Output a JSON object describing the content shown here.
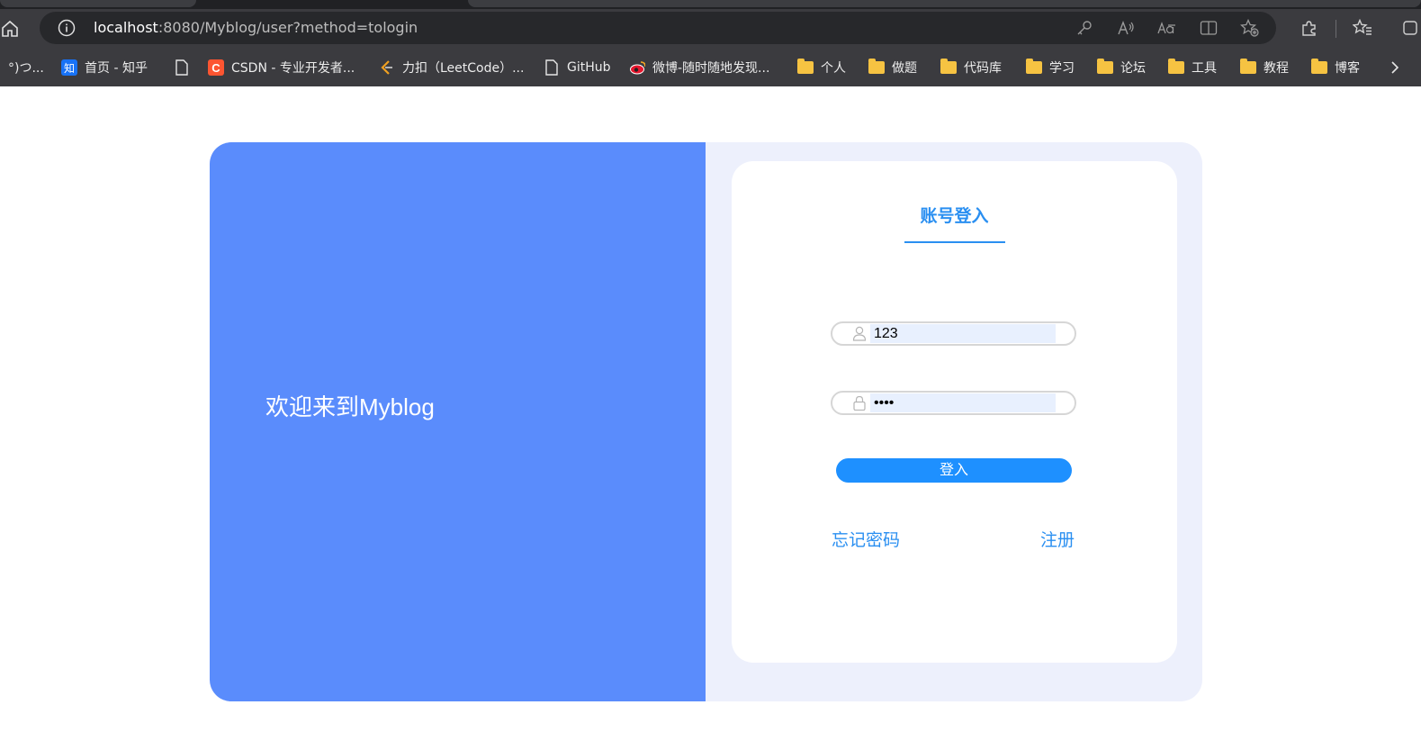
{
  "browser": {
    "url_host": "localhost",
    "url_rest": ":8080/Myblog/user?method=tologin",
    "url_icons": [
      "key-icon",
      "read-aloud-icon",
      "translate-icon",
      "split-screen-icon",
      "add-favorite-icon"
    ],
    "toolbar_icons": [
      "extensions-icon",
      "favorites-icon",
      "collections-icon"
    ]
  },
  "bookmarks": [
    {
      "label": "°)つ...",
      "icon": "none"
    },
    {
      "label": "首页 - 知乎",
      "icon": "zhihu-icon"
    },
    {
      "label": "",
      "icon": "page-icon"
    },
    {
      "label": "CSDN - 专业开发者...",
      "icon": "csdn-icon"
    },
    {
      "label": "力扣（LeetCode）...",
      "icon": "leetcode-icon"
    },
    {
      "label": "GitHub",
      "icon": "page-icon"
    },
    {
      "label": "微博-随时随地发现...",
      "icon": "weibo-icon"
    },
    {
      "label": "个人",
      "icon": "folder-icon"
    },
    {
      "label": "做题",
      "icon": "folder-icon"
    },
    {
      "label": "代码库",
      "icon": "folder-icon"
    },
    {
      "label": "学习",
      "icon": "folder-icon"
    },
    {
      "label": "论坛",
      "icon": "folder-icon"
    },
    {
      "label": "工具",
      "icon": "folder-icon"
    },
    {
      "label": "教程",
      "icon": "folder-icon"
    },
    {
      "label": "博客",
      "icon": "folder-icon"
    }
  ],
  "page": {
    "welcome": "欢迎来到Myblog",
    "login_title": "账号登入",
    "username_value": "123",
    "password_value": "••••",
    "login_button": "登入",
    "forgot_link": "忘记密码",
    "register_link": "注册",
    "colors": {
      "left_panel": "#5a8cfc",
      "accent": "#2a8ff1",
      "button": "#1e90ff",
      "card_bg": "#edf0fc"
    }
  }
}
